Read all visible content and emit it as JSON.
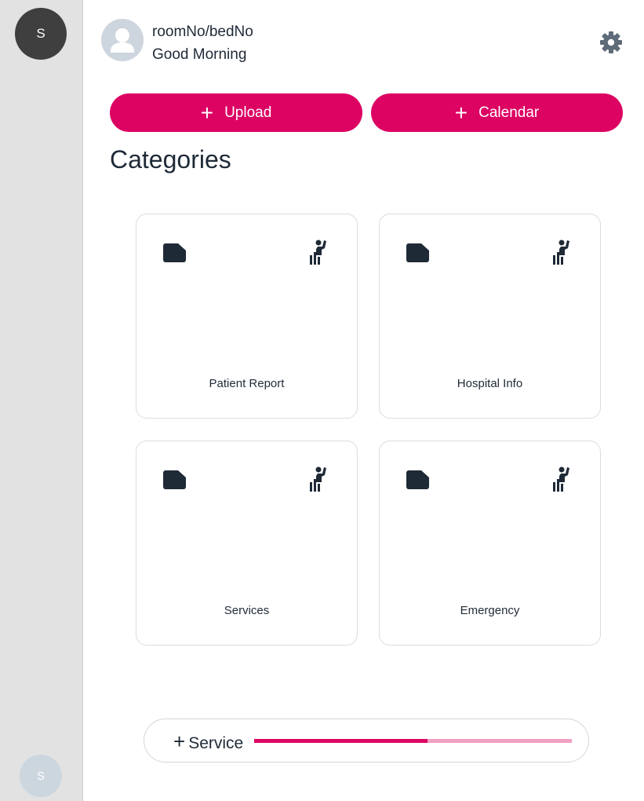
{
  "sidebar": {
    "top_avatar_initial": "S",
    "bottom_avatar_initial": "S"
  },
  "header": {
    "room_text": "roomNo/bedNo",
    "greeting": "Good Morning",
    "settings_icon": "gear-icon"
  },
  "actions": {
    "upload_label": "Upload",
    "calendar_label": "Calendar",
    "plus_glyph": "+"
  },
  "categories": {
    "title": "Categories",
    "items": [
      {
        "label": "Patient Report",
        "left_icon": "folder-icon",
        "right_icon": "person-waving-icon"
      },
      {
        "label": "Hospital Info",
        "left_icon": "folder-icon",
        "right_icon": "person-waving-icon"
      },
      {
        "label": "Services",
        "left_icon": "folder-icon",
        "right_icon": "person-waving-icon"
      },
      {
        "label": "Emergency",
        "left_icon": "folder-icon",
        "right_icon": "person-waving-icon"
      }
    ]
  },
  "service": {
    "label": "Service",
    "plus_glyph": "+",
    "progress": 0.545
  },
  "colors": {
    "accent": "#dc0363",
    "accent_light": "#f0a0c2",
    "sidebar_bg": "#e2e2e2",
    "text_dark": "#1f2a37",
    "icon_gray": "#5f6b78"
  }
}
